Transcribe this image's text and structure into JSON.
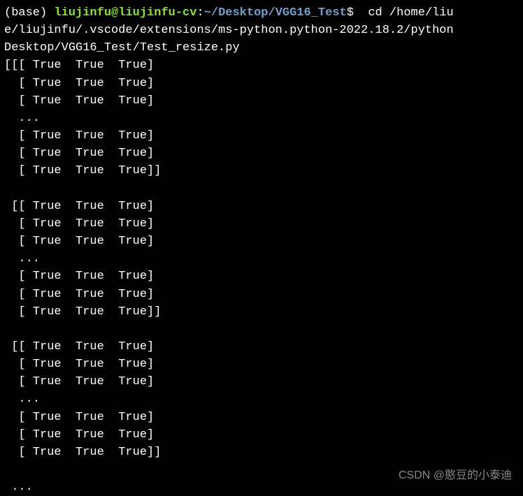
{
  "prompt": {
    "env": "(base) ",
    "user": "liujinfu@liujinfu-cv",
    "colon": ":",
    "path": "~/Desktop/VGG16_Test",
    "dollar": "$"
  },
  "command": "  cd /home/liu",
  "command_wrap1": "e/liujinfu/.vscode/extensions/ms-python.python-2022.18.2/python",
  "command_wrap2": "Desktop/VGG16_Test/Test_resize.py",
  "output_lines": {
    "l01": "[[[ True  True  True]",
    "l02": "  [ True  True  True]",
    "l03": "  [ True  True  True]",
    "l04": "  ...",
    "l05": "  [ True  True  True]",
    "l06": "  [ True  True  True]",
    "l07": "  [ True  True  True]]",
    "l08": "",
    "l09": " [[ True  True  True]",
    "l10": "  [ True  True  True]",
    "l11": "  [ True  True  True]",
    "l12": "  ...",
    "l13": "  [ True  True  True]",
    "l14": "  [ True  True  True]",
    "l15": "  [ True  True  True]]",
    "l16": "",
    "l17": " [[ True  True  True]",
    "l18": "  [ True  True  True]",
    "l19": "  [ True  True  True]",
    "l20": "  ...",
    "l21": "  [ True  True  True]",
    "l22": "  [ True  True  True]",
    "l23": "  [ True  True  True]]",
    "l24": "",
    "l25": " ..."
  },
  "watermark": "CSDN @憨豆的小泰迪"
}
